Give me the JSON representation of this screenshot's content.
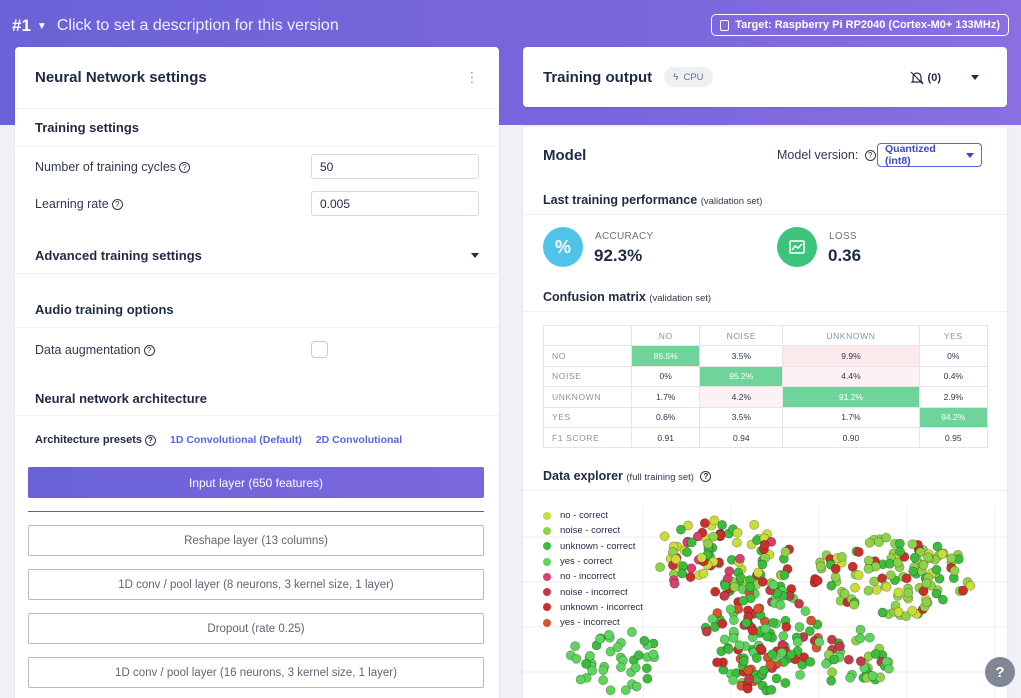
{
  "header": {
    "version": "#1",
    "description": "Click to set a description for this version",
    "target": "Target: Raspberry Pi RP2040 (Cortex-M0+ 133MHz)"
  },
  "nn_settings": {
    "title": "Neural Network settings",
    "training_settings": "Training settings",
    "cycles_label": "Number of training cycles",
    "cycles_value": "50",
    "lr_label": "Learning rate",
    "lr_value": "0.005",
    "advanced": "Advanced training settings",
    "audio_options": "Audio training options",
    "augmentation_label": "Data augmentation",
    "augmentation_checked": false,
    "architecture": "Neural network architecture",
    "presets_label": "Architecture presets",
    "preset_1d": "1D Convolutional (Default)",
    "preset_2d": "2D Convolutional",
    "input_layer": "Input layer (650 features)",
    "layers": [
      "Reshape layer (13 columns)",
      "1D conv / pool layer (8 neurons, 3 kernel size, 1 layer)",
      "Dropout (rate 0.25)",
      "1D conv / pool layer (16 neurons, 3 kernel size, 1 layer)"
    ]
  },
  "training_output": {
    "title": "Training output",
    "device": "CPU",
    "notifications": "(0)"
  },
  "model": {
    "title": "Model",
    "version_label": "Model version:",
    "version_value": "Quantized (int8)",
    "last_perf": "Last training performance",
    "last_perf_note": "(validation set)",
    "accuracy_label": "ACCURACY",
    "accuracy_value": "92.3%",
    "loss_label": "LOSS",
    "loss_value": "0.36",
    "accuracy_color": "#4fc3e8",
    "loss_color": "#3cc47c",
    "confusion_title": "Confusion matrix",
    "confusion_note": "(validation set)",
    "confusion": {
      "columns": [
        "NO",
        "NOISE",
        "UNKNOWN",
        "YES"
      ],
      "rows": [
        {
          "label": "NO",
          "values": [
            "86.5%",
            "3.5%",
            "9.9%",
            "0%"
          ]
        },
        {
          "label": "NOISE",
          "values": [
            "0%",
            "95.2%",
            "4.4%",
            "0.4%"
          ]
        },
        {
          "label": "UNKNOWN",
          "values": [
            "1.7%",
            "4.2%",
            "91.2%",
            "2.9%"
          ]
        },
        {
          "label": "YES",
          "values": [
            "0.6%",
            "3.5%",
            "1.7%",
            "94.2%"
          ]
        },
        {
          "label": "F1 SCORE",
          "values": [
            "0.91",
            "0.94",
            "0.90",
            "0.95"
          ]
        }
      ]
    },
    "explorer_title": "Data explorer",
    "explorer_note": "(full training set)",
    "legend": [
      {
        "label": "no - correct",
        "color": "#c9dc3a"
      },
      {
        "label": "noise - correct",
        "color": "#8fd24a"
      },
      {
        "label": "unknown - correct",
        "color": "#3cbb3c"
      },
      {
        "label": "yes - correct",
        "color": "#5ed35e"
      },
      {
        "label": "no - incorrect",
        "color": "#d6406a"
      },
      {
        "label": "noise - incorrect",
        "color": "#c43a48"
      },
      {
        "label": "unknown - incorrect",
        "color": "#c9302c"
      },
      {
        "label": "yes - incorrect",
        "color": "#d8542e"
      }
    ]
  }
}
